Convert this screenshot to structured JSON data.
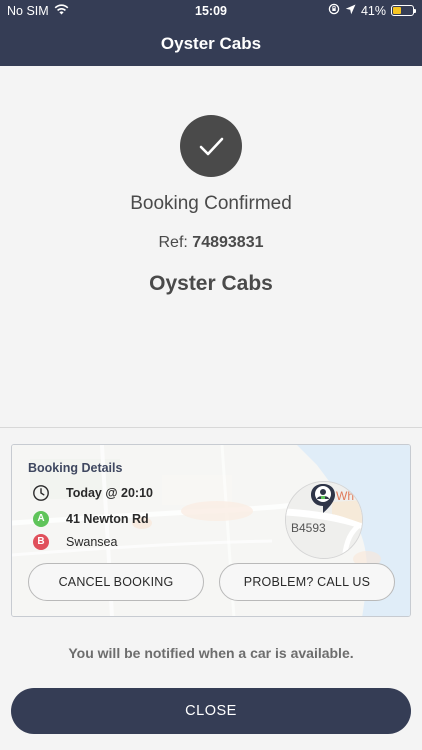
{
  "status_bar": {
    "carrier": "No SIM",
    "time": "15:09",
    "battery_percent": "41%",
    "battery_level": 0.41,
    "icons": [
      "wifi-icon",
      "rotation-lock-icon",
      "location-arrow-icon",
      "battery-icon"
    ]
  },
  "nav": {
    "title": "Oyster Cabs"
  },
  "confirmation": {
    "status": "Booking Confirmed",
    "ref_label": "Ref:",
    "ref_number": "74893831",
    "company": "Oyster Cabs",
    "icon": "checkmark-icon"
  },
  "booking_details": {
    "title": "Booking Details",
    "time": "Today @ 20:10",
    "pickup_marker": "A",
    "pickup": "41 Newton Rd",
    "dropoff_marker": "B",
    "dropoff": "Swansea",
    "map": {
      "road_label": "B4593",
      "place_label": "Wh"
    },
    "cancel_label": "CANCEL BOOKING",
    "problem_label": "PROBLEM? CALL US"
  },
  "notice": "You will be notified when a car is available.",
  "close_label": "CLOSE",
  "colors": {
    "header": "#353d55",
    "pickup": "#5fc45a",
    "dropoff": "#e0505b",
    "battery": "#f7c623"
  }
}
